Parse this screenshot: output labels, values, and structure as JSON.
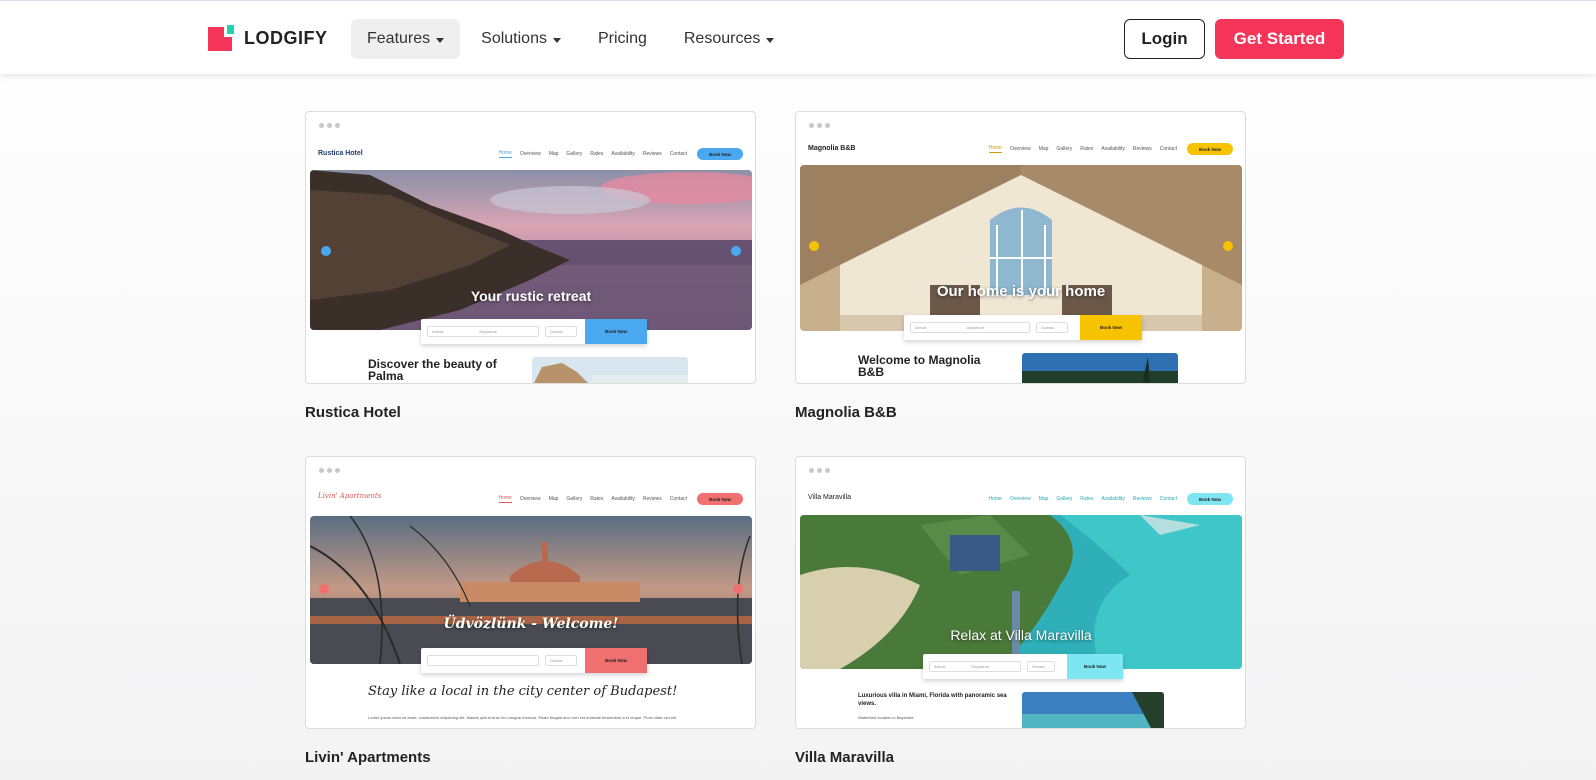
{
  "header": {
    "logo_text": "LODGIFY",
    "nav": [
      {
        "label": "Features",
        "dropdown": true,
        "active": true
      },
      {
        "label": "Solutions",
        "dropdown": true,
        "active": false
      },
      {
        "label": "Pricing",
        "dropdown": false,
        "active": false
      },
      {
        "label": "Resources",
        "dropdown": true,
        "active": false
      }
    ],
    "login_label": "Login",
    "cta_label": "Get Started"
  },
  "colors": {
    "brand_red": "#f5345a",
    "brand_teal": "#1dd3b0",
    "rustica_accent": "#4aa8f0",
    "magnolia_accent": "#f7c300",
    "livin_accent": "#f07070",
    "villa_accent": "#7ee6f0"
  },
  "cards": [
    {
      "label": "Rustica Hotel",
      "site_title": "Rustica Hotel",
      "nav_links": [
        "Home",
        "Overview",
        "Map",
        "Gallery",
        "Rates",
        "Availability",
        "Reviews",
        "Contact"
      ],
      "book_label": "Book Now",
      "hero_text": "Your rustic retreat",
      "arrival": "Arrival",
      "departure": "Departure",
      "guests": "Guests",
      "search_btn": "Book Now",
      "content_title": "Discover the beauty of Palma"
    },
    {
      "label": "Magnolia B&B",
      "site_title": "Magnolia B&B",
      "nav_links": [
        "Home",
        "Overview",
        "Map",
        "Gallery",
        "Rates",
        "Availability",
        "Reviews",
        "Contact"
      ],
      "book_label": "Book Now",
      "hero_text": "Our home is your home",
      "arrival": "Arrival",
      "departure": "Departure",
      "guests": "Guests",
      "search_btn": "Book Now",
      "content_title": "Welcome to Magnolia B&B"
    },
    {
      "label": "Livin' Apartments",
      "site_title": "Livin' Apartments",
      "nav_links": [
        "Home",
        "Overview",
        "Map",
        "Gallery",
        "Rates",
        "Availability",
        "Reviews",
        "Contact"
      ],
      "book_label": "Book Now",
      "hero_text": "Üdvözlünk - Welcome!",
      "arrival": "",
      "departure": "",
      "guests": "Guests",
      "search_btn": "Book Now",
      "content_title": "Stay like a local in the city center of Budapest!",
      "lorem": "Lorem ipsum dolor sit amet, consectetur adipiscing elit. Mauris quis erat ac leo congue rhoncus. Etiam feugiat arcu non est molestie fermentum a et neque. Proin vitae orci elit."
    },
    {
      "label": "Villa Maravilla",
      "site_title": "Villa Maravilla",
      "nav_links": [
        "Home",
        "Overview",
        "Map",
        "Gallery",
        "Rates",
        "Availability",
        "Reviews",
        "Contact"
      ],
      "book_label": "Book Now",
      "hero_text": "Relax at Villa Maravilla",
      "arrival": "Arrival",
      "departure": "Departure",
      "guests": "Guests",
      "search_btn": "Book Now",
      "content_title": "Luxurious villa in Miami, Florida with panoramic sea views.",
      "lorem": "Waterfront location in Bayshore"
    }
  ]
}
